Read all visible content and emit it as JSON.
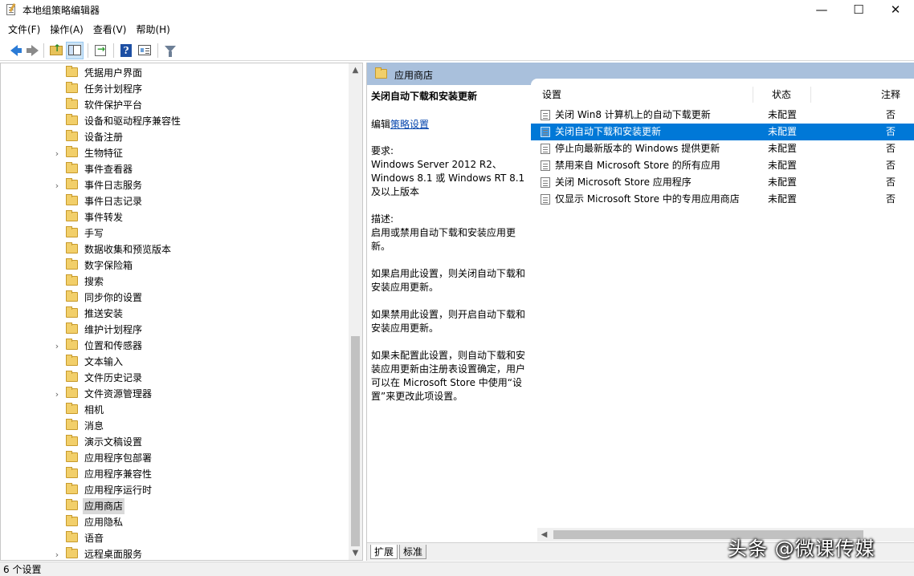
{
  "window": {
    "title": "本地组策略编辑器",
    "controls": {
      "minimize": "—",
      "maximize": "☐",
      "close": "✕"
    }
  },
  "menubar": {
    "items": [
      "文件(F)",
      "操作(A)",
      "查看(V)",
      "帮助(H)"
    ]
  },
  "toolbar": {
    "icons": [
      "back-arrow-icon",
      "forward-arrow-icon",
      "folder-up-icon",
      "show-hide-tree-icon",
      "export-list-icon",
      "help-icon",
      "properties-icon",
      "filter-icon"
    ],
    "help_glyph": "?"
  },
  "tree": {
    "items": [
      {
        "label": "凭据用户界面",
        "expandable": false,
        "selected": false
      },
      {
        "label": "任务计划程序",
        "expandable": false,
        "selected": false
      },
      {
        "label": "软件保护平台",
        "expandable": false,
        "selected": false
      },
      {
        "label": "设备和驱动程序兼容性",
        "expandable": false,
        "selected": false
      },
      {
        "label": "设备注册",
        "expandable": false,
        "selected": false
      },
      {
        "label": "生物特征",
        "expandable": true,
        "selected": false
      },
      {
        "label": "事件查看器",
        "expandable": false,
        "selected": false
      },
      {
        "label": "事件日志服务",
        "expandable": true,
        "selected": false
      },
      {
        "label": "事件日志记录",
        "expandable": false,
        "selected": false
      },
      {
        "label": "事件转发",
        "expandable": false,
        "selected": false
      },
      {
        "label": "手写",
        "expandable": false,
        "selected": false
      },
      {
        "label": "数据收集和预览版本",
        "expandable": false,
        "selected": false
      },
      {
        "label": "数字保险箱",
        "expandable": false,
        "selected": false
      },
      {
        "label": "搜索",
        "expandable": false,
        "selected": false
      },
      {
        "label": "同步你的设置",
        "expandable": false,
        "selected": false
      },
      {
        "label": "推送安装",
        "expandable": false,
        "selected": false
      },
      {
        "label": "维护计划程序",
        "expandable": false,
        "selected": false
      },
      {
        "label": "位置和传感器",
        "expandable": true,
        "selected": false
      },
      {
        "label": "文本输入",
        "expandable": false,
        "selected": false
      },
      {
        "label": "文件历史记录",
        "expandable": false,
        "selected": false
      },
      {
        "label": "文件资源管理器",
        "expandable": true,
        "selected": false
      },
      {
        "label": "相机",
        "expandable": false,
        "selected": false
      },
      {
        "label": "消息",
        "expandable": false,
        "selected": false
      },
      {
        "label": "演示文稿设置",
        "expandable": false,
        "selected": false
      },
      {
        "label": "应用程序包部署",
        "expandable": false,
        "selected": false
      },
      {
        "label": "应用程序兼容性",
        "expandable": false,
        "selected": false
      },
      {
        "label": "应用程序运行时",
        "expandable": false,
        "selected": false
      },
      {
        "label": "应用商店",
        "expandable": false,
        "selected": true
      },
      {
        "label": "应用隐私",
        "expandable": false,
        "selected": false
      },
      {
        "label": "语音",
        "expandable": false,
        "selected": false
      },
      {
        "label": "远程桌面服务",
        "expandable": true,
        "selected": false
      }
    ],
    "expander_glyph": "›",
    "scroll_up": "▲",
    "scroll_down": "▼"
  },
  "right_pane": {
    "header_title": "应用商店",
    "description": {
      "title": "关闭自动下载和安装更新",
      "edit_prefix": "编辑",
      "edit_link": "策略设置",
      "requirements_label": "要求:",
      "requirements_text": "Windows Server 2012 R2、Windows 8.1 或 Windows RT 8.1 及以上版本",
      "description_label": "描述:",
      "description_text": "启用或禁用自动下载和安装应用更新。",
      "enabled_text": "如果启用此设置，则关闭自动下载和安装应用更新。",
      "disabled_text": "如果禁用此设置，则开启自动下载和安装应用更新。",
      "not_configured_text": "如果未配置此设置，则自动下载和安装应用更新由注册表设置确定，用户可以在 Microsoft Store 中使用“设置”来更改此项设置。"
    },
    "list": {
      "columns": {
        "setting": "设置",
        "state": "状态",
        "note": "注释"
      },
      "rows": [
        {
          "name": "关闭 Win8 计算机上的自动下载更新",
          "state": "未配置",
          "note": "否",
          "selected": false
        },
        {
          "name": "关闭自动下载和安装更新",
          "state": "未配置",
          "note": "否",
          "selected": true
        },
        {
          "name": "停止向最新版本的 Windows 提供更新",
          "state": "未配置",
          "note": "否",
          "selected": false
        },
        {
          "name": "禁用来自 Microsoft Store 的所有应用",
          "state": "未配置",
          "note": "否",
          "selected": false
        },
        {
          "name": "关闭 Microsoft Store 应用程序",
          "state": "未配置",
          "note": "否",
          "selected": false
        },
        {
          "name": "仅显示 Microsoft Store 中的专用应用商店",
          "state": "未配置",
          "note": "否",
          "selected": false
        }
      ],
      "scroll_left": "◀"
    },
    "tabs": [
      "扩展",
      "标准"
    ]
  },
  "statusbar": {
    "text": "6 个设置"
  },
  "watermark": "头条 @微课传媒",
  "colors": {
    "selection": "#0078d7",
    "header_band": "#a9c0dc",
    "folder": "#f2cf6a",
    "link": "#0645ad"
  }
}
